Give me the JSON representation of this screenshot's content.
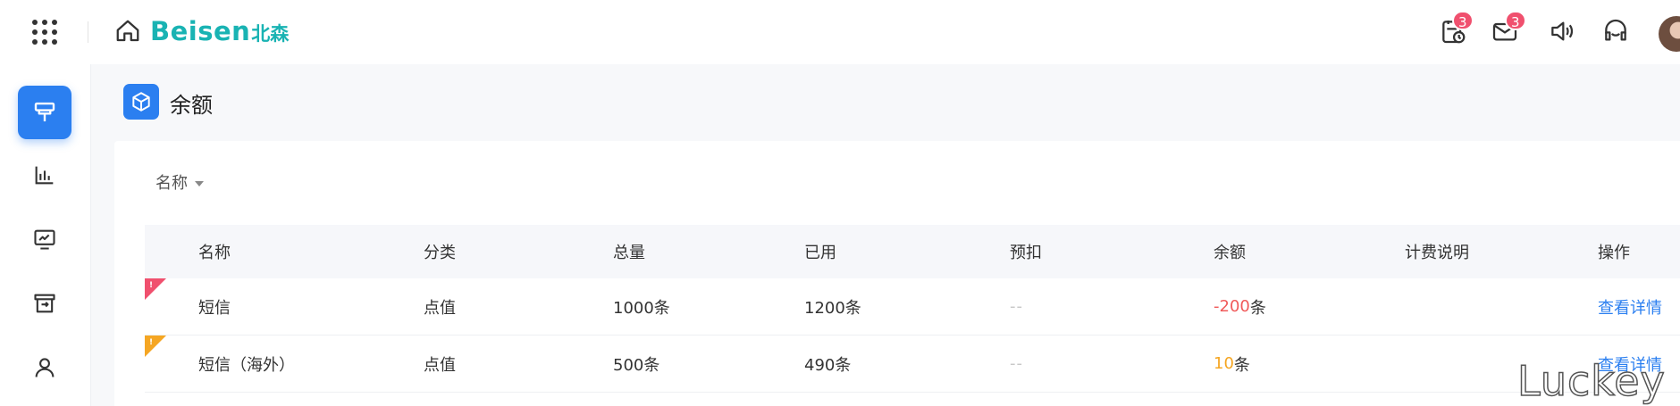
{
  "header": {
    "logo_latin": "Beisen",
    "logo_cn": "北森",
    "badges": {
      "tasks": "3",
      "mail": "3"
    }
  },
  "page": {
    "title": "余额"
  },
  "filter": {
    "label": "名称"
  },
  "table": {
    "columns": [
      "名称",
      "分类",
      "总量",
      "已用",
      "预扣",
      "余额",
      "计费说明",
      "操作"
    ],
    "rows": [
      {
        "flag_color": "#f0506e",
        "name": "短信",
        "category": "点值",
        "total": "1000条",
        "used": "1200条",
        "reserved": "--",
        "balance_num": "-200",
        "balance_unit": "条",
        "balance_color": "#f05a5a",
        "billing": "",
        "action": "查看详情"
      },
      {
        "flag_color": "#f5a623",
        "name": "短信（海外）",
        "category": "点值",
        "total": "500条",
        "used": "490条",
        "reserved": "--",
        "balance_num": "10",
        "balance_unit": "条",
        "balance_color": "#f5a623",
        "billing": "",
        "action": "查看详情"
      }
    ]
  },
  "watermark": "Luckey",
  "colors": {
    "accent": "#2b7ff0",
    "brand": "#19b3b3",
    "danger": "#f05a5a",
    "warning": "#f5a623"
  }
}
